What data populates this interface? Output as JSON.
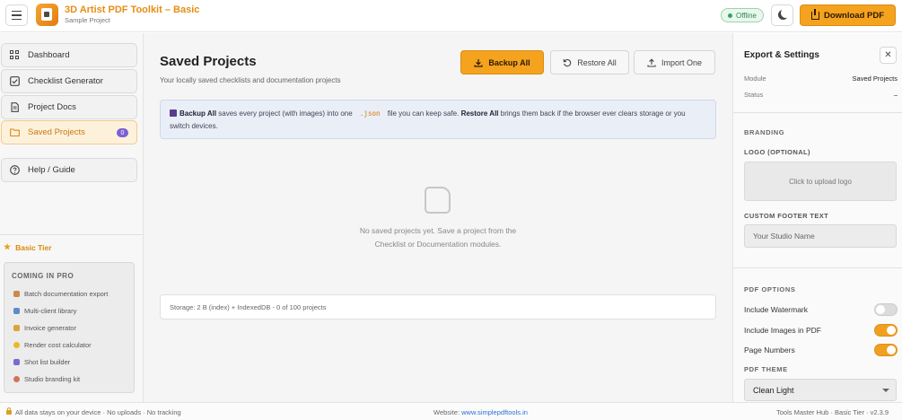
{
  "header": {
    "app_title": "3D Artist PDF Toolkit – Basic",
    "app_subtitle": "Sample Project",
    "status_badge": "Offline",
    "download_label": "Download PDF"
  },
  "sidebar": {
    "items": [
      {
        "label": "Dashboard",
        "icon": "grid-icon"
      },
      {
        "label": "Checklist Generator",
        "icon": "checkbox-icon"
      },
      {
        "label": "Project Docs",
        "icon": "document-icon"
      },
      {
        "label": "Saved Projects",
        "icon": "folder-icon",
        "badge": "0",
        "active": true
      },
      {
        "label": "Help / Guide",
        "icon": "help-icon"
      }
    ],
    "tier_label": "Basic Tier",
    "pro_title": "COMING IN PRO",
    "pro_items": [
      {
        "label": "Batch documentation export",
        "icon": "package-icon",
        "color": "#c98a4a"
      },
      {
        "label": "Multi-client library",
        "icon": "books-icon",
        "color": "#5b8cc9"
      },
      {
        "label": "Invoice generator",
        "icon": "money-icon",
        "color": "#d9a43a"
      },
      {
        "label": "Render cost calculator",
        "icon": "bulb-icon",
        "color": "#e8b92c"
      },
      {
        "label": "Shot list builder",
        "icon": "clapper-icon",
        "color": "#7a6ad0"
      },
      {
        "label": "Studio branding kit",
        "icon": "palette-icon",
        "color": "#d0735b"
      }
    ]
  },
  "main": {
    "title": "Saved Projects",
    "subtitle": "Your locally saved checklists and documentation projects",
    "backup_label": "Backup All",
    "restore_label": "Restore All",
    "import_label": "Import One",
    "info": {
      "bold1": "Backup All",
      "text1": "saves every project (with images) into one",
      "code": ".json",
      "text2": "file you can keep safe.",
      "bold2": "Restore All",
      "text3": "brings them back if the browser ever clears storage or you switch devices."
    },
    "empty_line1": "No saved projects yet. Save a project from the",
    "empty_line2": "Checklist or Documentation modules.",
    "storage": "Storage: 2 B (index) + IndexedDB - 0 of 100 projects"
  },
  "right_panel": {
    "title": "Export & Settings",
    "module_key": "Module",
    "module_value": "Saved Projects",
    "status_key": "Status",
    "status_value": "–",
    "branding_section": "BRANDING",
    "logo_label": "LOGO (OPTIONAL)",
    "logo_upload": "Click to upload logo",
    "footer_label": "CUSTOM FOOTER TEXT",
    "footer_placeholder": "Your Studio Name",
    "pdf_options_section": "PDF OPTIONS",
    "toggles": [
      {
        "label": "Include Watermark",
        "on": false
      },
      {
        "label": "Include Images in PDF",
        "on": true
      },
      {
        "label": "Page Numbers",
        "on": true
      }
    ],
    "theme_label": "PDF THEME",
    "theme_value": "Clean Light"
  },
  "footer": {
    "left": "All data stays on your device · No uploads · No tracking",
    "mid_prefix": "Website:",
    "mid_link": "www.simplepdftools.in",
    "right": "Tools Master Hub · Basic Tier · v2.3.9"
  }
}
